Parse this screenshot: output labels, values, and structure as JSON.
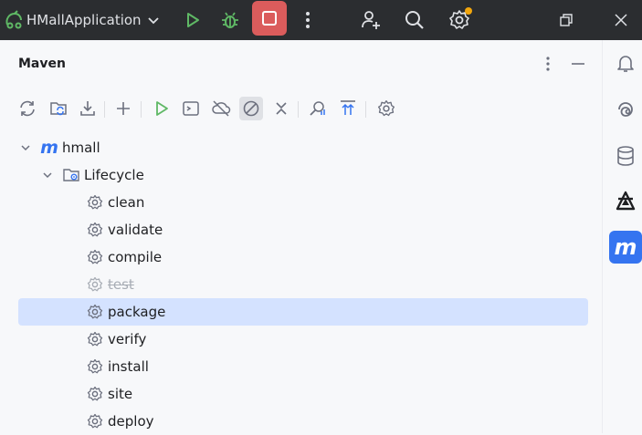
{
  "titlebar": {
    "app_name": "HMallApplication",
    "icons": [
      "chevron-down-icon",
      "run-icon",
      "debug-icon",
      "stop-icon",
      "more-vertical-icon",
      "add-user-icon",
      "search-icon",
      "settings-icon",
      "restore-window-icon",
      "close-icon"
    ],
    "stop_color": "#db5c5c",
    "badge_color": "#f2a60d"
  },
  "panel": {
    "title": "Maven",
    "toolbar_icons": [
      "reload-icon",
      "reimport-folder-icon",
      "download-icon",
      "add-icon",
      "run-icon",
      "execute-goal-icon",
      "offline-icon",
      "skip-tests-icon",
      "collapse-icon",
      "analyze-icon",
      "show-dependencies-icon",
      "settings-icon"
    ]
  },
  "tree": {
    "root": {
      "label": "hmall",
      "icon": "maven-m-icon"
    },
    "lifecycle": {
      "label": "Lifecycle",
      "icon": "folder-settings-icon"
    },
    "goals": [
      {
        "label": "clean",
        "skipped": false,
        "selected": false
      },
      {
        "label": "validate",
        "skipped": false,
        "selected": false
      },
      {
        "label": "compile",
        "skipped": false,
        "selected": false
      },
      {
        "label": "test",
        "skipped": true,
        "selected": false
      },
      {
        "label": "package",
        "skipped": false,
        "selected": true
      },
      {
        "label": "verify",
        "skipped": false,
        "selected": false
      },
      {
        "label": "install",
        "skipped": false,
        "selected": false
      },
      {
        "label": "site",
        "skipped": false,
        "selected": false
      },
      {
        "label": "deploy",
        "skipped": false,
        "selected": false
      }
    ]
  },
  "rightbar": {
    "icons": [
      "notifications-icon",
      "ai-assistant-icon",
      "database-icon",
      "plugin-icon",
      "maven-icon"
    ],
    "active_color": "#3574f0"
  },
  "colors": {
    "selection": "#d4e2ff",
    "accent": "#3574f0",
    "run_green": "#5fb865"
  }
}
